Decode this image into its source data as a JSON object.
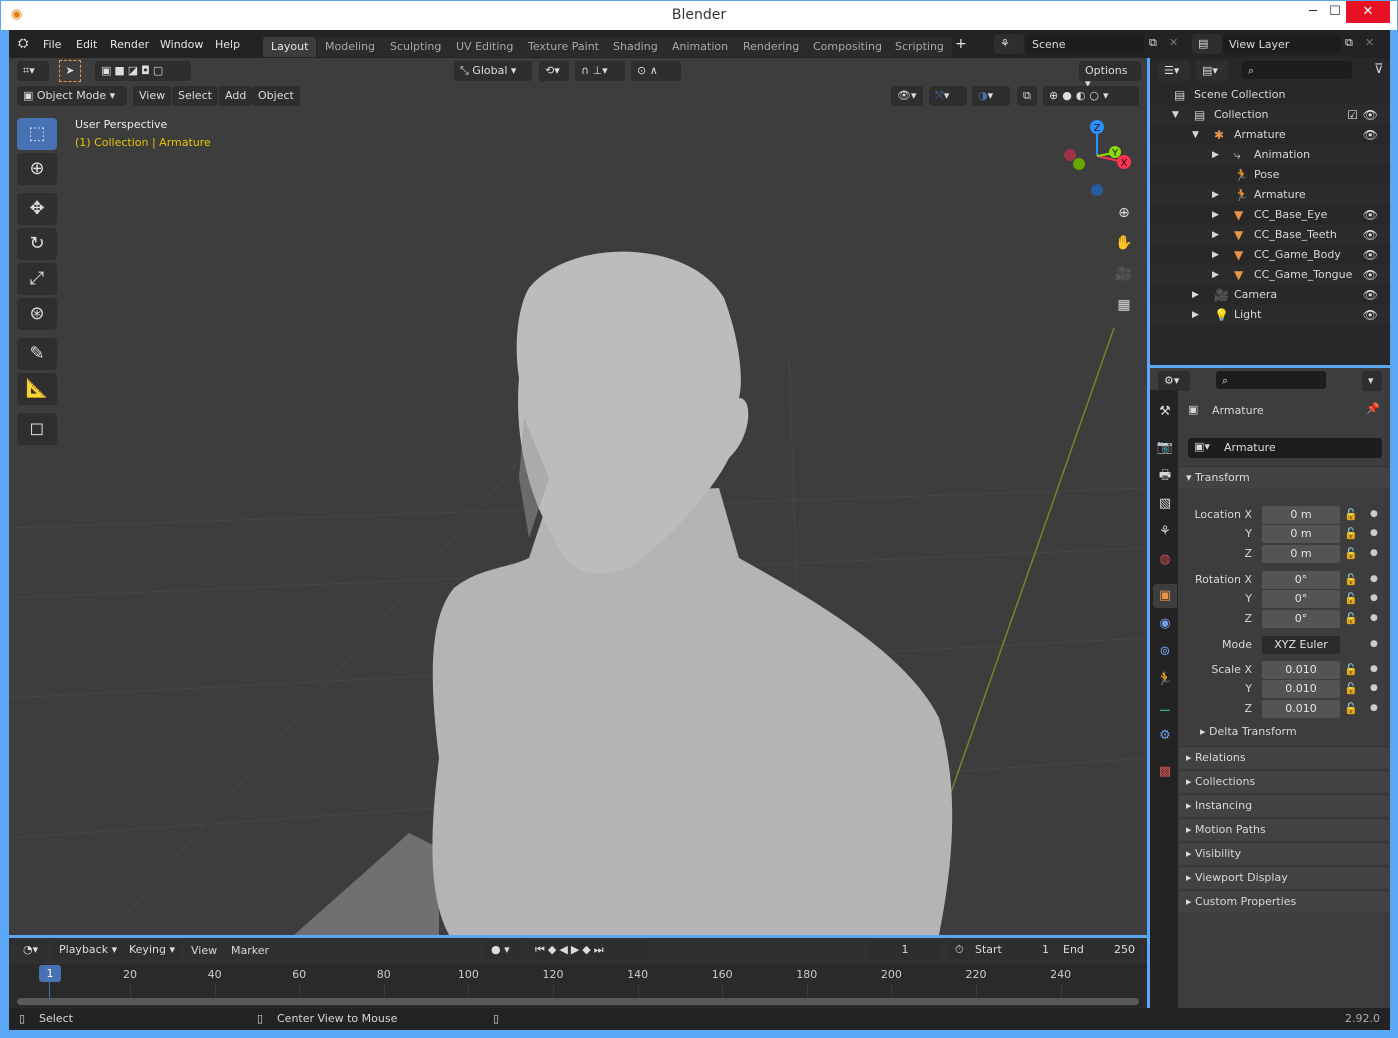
{
  "window": {
    "title": "Blender",
    "minimize": "─",
    "maximize": "☐",
    "close": "✕"
  },
  "topbar": {
    "menus": [
      "File",
      "Edit",
      "Render",
      "Window",
      "Help"
    ],
    "workspaces": [
      "Layout",
      "Modeling",
      "Sculpting",
      "UV Editing",
      "Texture Paint",
      "Shading",
      "Animation",
      "Rendering",
      "Compositing",
      "Scripting"
    ],
    "active_workspace": "Layout",
    "add_tab": "+",
    "scene": "Scene",
    "view_layer": "View Layer"
  },
  "viewport": {
    "transform_orientation": "Global",
    "options": "Options",
    "mode": "Object Mode",
    "menus": [
      "View",
      "Select",
      "Add",
      "Object"
    ],
    "overlay_title": "User Perspective",
    "overlay_subtitle": "(1) Collection | Armature",
    "gizmo": {
      "x": "X",
      "y": "Y",
      "z": "Z"
    }
  },
  "outliner": {
    "items": [
      {
        "label": "Scene Collection",
        "indent": 0,
        "icon": "scene-collection-icon",
        "color": "#cccccc"
      },
      {
        "label": "Collection",
        "indent": 1,
        "icon": "collection-icon",
        "color": "#cccccc",
        "eye": true,
        "check": true
      },
      {
        "label": "Armature",
        "indent": 2,
        "icon": "armature-object-icon",
        "color": "#e8954a",
        "eye": true
      },
      {
        "label": "Animation",
        "indent": 3,
        "icon": "animation-icon",
        "color": "#cccccc"
      },
      {
        "label": "Pose",
        "indent": 3,
        "icon": "pose-icon",
        "color": "#2ab58e"
      },
      {
        "label": "Armature",
        "indent": 3,
        "icon": "armature-data-icon",
        "color": "#2ab58e"
      },
      {
        "label": "CC_Base_Eye",
        "indent": 3,
        "icon": "mesh-icon",
        "color": "#e8954a",
        "eye": true
      },
      {
        "label": "CC_Base_Teeth",
        "indent": 3,
        "icon": "mesh-icon",
        "color": "#e8954a",
        "eye": true
      },
      {
        "label": "CC_Game_Body",
        "indent": 3,
        "icon": "mesh-icon",
        "color": "#e8954a",
        "eye": true
      },
      {
        "label": "CC_Game_Tongue",
        "indent": 3,
        "icon": "mesh-icon",
        "color": "#e8954a",
        "eye": true
      },
      {
        "label": "Camera",
        "indent": 2,
        "icon": "camera-icon",
        "color": "#e8954a",
        "eye": true
      },
      {
        "label": "Light",
        "indent": 2,
        "icon": "light-icon",
        "color": "#e8954a",
        "eye": true
      }
    ]
  },
  "properties": {
    "object_name": "Armature",
    "data_name": "Armature",
    "transform_header": "Transform",
    "location": {
      "label": "Location X",
      "x": "0 m",
      "y": "0 m",
      "z": "0 m"
    },
    "rotation": {
      "label": "Rotation X",
      "x": "0°",
      "y": "0°",
      "z": "0°"
    },
    "mode_label": "Mode",
    "mode": "XYZ Euler",
    "scale": {
      "label": "Scale X",
      "x": "0.010",
      "y": "0.010",
      "z": "0.010"
    },
    "axis_y": "Y",
    "axis_z": "Z",
    "delta": "Delta Transform",
    "panels": [
      "Relations",
      "Collections",
      "Instancing",
      "Motion Paths",
      "Visibility",
      "Viewport Display",
      "Custom Properties"
    ]
  },
  "timeline": {
    "menus": [
      "Playback",
      "Keying",
      "View",
      "Marker"
    ],
    "current_frame": "1",
    "start_label": "Start",
    "start": "1",
    "end_label": "End",
    "end": "250",
    "ticks": [
      "20",
      "40",
      "60",
      "80",
      "100",
      "120",
      "140",
      "160",
      "180",
      "200",
      "220",
      "240"
    ],
    "playhead": "1"
  },
  "statusbar": {
    "left": "Select",
    "middle": "Center View to Mouse",
    "version": "2.92.0"
  },
  "colors": {
    "accent": "#4772b3",
    "object_orange": "#e8954a",
    "data_green": "#2ab58e",
    "x_axis": "#ff3352",
    "y_axis": "#8bdc00",
    "z_axis": "#2890ff"
  }
}
